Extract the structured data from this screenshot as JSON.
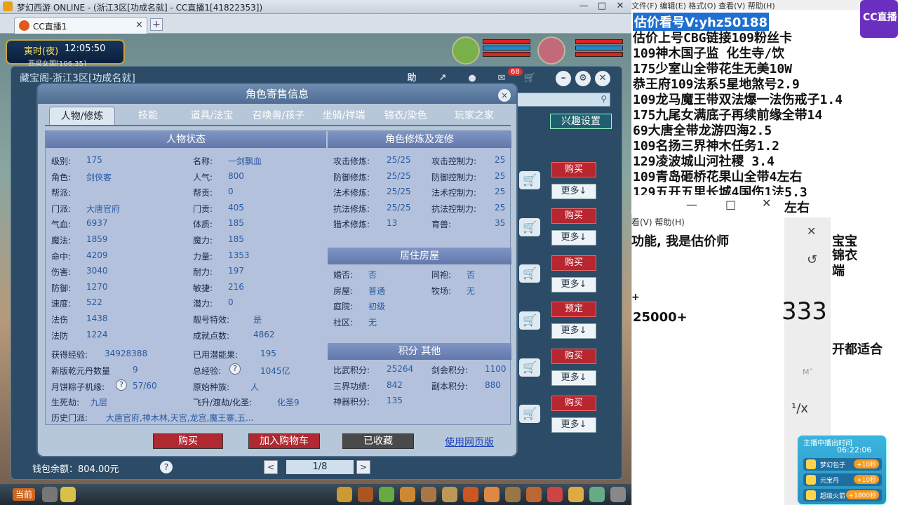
{
  "window": {
    "title": "梦幻西游 ONLINE - (浙江3区[功成名就] - CC直播1[41822353])"
  },
  "browser": {
    "tab_label": "CC直播1",
    "tab_close": "×",
    "new_tab": "+"
  },
  "clock": {
    "period": "寅时(夜)",
    "time": "12:05:50",
    "location": "西梁女国[106,35]"
  },
  "main": {
    "header": "藏宝阁-浙江3区[功成名就]",
    "help_icon": "助",
    "notify_count": "68",
    "hobby_button": "兴趣设置",
    "buttons": {
      "buy": "购买",
      "more": "更多↓",
      "reserve": "预定"
    },
    "wallet": "钱包余额：804.00元",
    "wallet_help": "?",
    "page": "1/8",
    "prev": "<",
    "next": ">"
  },
  "dialog": {
    "title": "角色寄售信息",
    "close": "×",
    "tabs": [
      "人物/修炼",
      "技能",
      "道具/法宝",
      "召唤兽/孩子",
      "坐骑/祥瑞",
      "锦衣/染色",
      "玩家之家"
    ],
    "status_title": "人物状态",
    "status_left": [
      [
        "级别:",
        "175"
      ],
      [
        "角色:",
        "剑侠客"
      ],
      [
        "帮派:",
        ""
      ],
      [
        "门派:",
        "大唐官府"
      ],
      [
        "气血:",
        "6937"
      ],
      [
        "魔法:",
        "1859"
      ],
      [
        "命中:",
        "4209"
      ],
      [
        "伤害:",
        "3040"
      ],
      [
        "防御:",
        "1270"
      ],
      [
        "速度:",
        "522"
      ],
      [
        "法伤",
        "1438"
      ],
      [
        "法防",
        "1224"
      ]
    ],
    "status_right": [
      [
        "名称:",
        "一剑飘血"
      ],
      [
        "人气:",
        "800"
      ],
      [
        "帮贡:",
        "0"
      ],
      [
        "门贡:",
        "405"
      ],
      [
        "体质:",
        "185"
      ],
      [
        "魔力:",
        "185"
      ],
      [
        "力量:",
        "1353"
      ],
      [
        "耐力:",
        "197"
      ],
      [
        "敏捷:",
        "216"
      ],
      [
        "潜力:",
        "0"
      ],
      [
        "靓号特效:",
        "是"
      ],
      [
        "成就点数:",
        "4862"
      ]
    ],
    "extra": {
      "exp_label": "获得经验:",
      "exp_val": "34928388",
      "potential_label": "已用潜能果:",
      "potential_val": "195",
      "qian_label": "新版乾元丹数量",
      "qian_val": "9",
      "total_exp_label": "总经验:",
      "total_exp_val": "1045亿",
      "mooncake_label": "月饼粽子机缘:",
      "mooncake_val": "57/60",
      "race_label": "原始种族:",
      "race_val": "人",
      "life_label": "生死劫:",
      "life_val": "九层",
      "fly_label": "飞升/渡劫/化圣:",
      "fly_val": "化圣9",
      "history_label": "历史门派:",
      "history_val": "大唐官府,神木林,天宫,龙宫,魔王寨,五...",
      "qmark": "?"
    },
    "cultivation_title": "角色修炼及宠修",
    "cultivation": [
      [
        "攻击修炼:",
        "25/25",
        "攻击控制力:",
        "25"
      ],
      [
        "防御修炼:",
        "25/25",
        "防御控制力:",
        "25"
      ],
      [
        "法术修炼:",
        "25/25",
        "法术控制力:",
        "25"
      ],
      [
        "抗法修炼:",
        "25/25",
        "抗法控制力:",
        "25"
      ],
      [
        "猎术修炼:",
        "13",
        "育兽:",
        "35"
      ]
    ],
    "house_title": "居住房屋",
    "house": [
      [
        "婚否:",
        "否",
        "同袍:",
        "否"
      ],
      [
        "房屋:",
        "普通",
        "牧场:",
        "无"
      ],
      [
        "庭院:",
        "初级",
        "",
        ""
      ],
      [
        "社区:",
        "无",
        "",
        ""
      ]
    ],
    "points_title": "积分 其他",
    "points": [
      [
        "比武积分:",
        "25264",
        "剑会积分:",
        "1100"
      ],
      [
        "三界功绩:",
        "842",
        "副本积分:",
        "880"
      ],
      [
        "神器积分:",
        "135",
        "",
        ""
      ]
    ],
    "actions": {
      "buy": "购买",
      "add_cart": "加入购物车",
      "favorited": "已收藏",
      "web": "使用网页版"
    }
  },
  "taskbar": {
    "current": "当前"
  },
  "right_panel": {
    "menu": "文件(F)    编辑(E)    格式(O)    查看(V)    帮助(H)",
    "highlight": "估价看号V:yhz50188",
    "lines": [
      "估价上号CBG链接109粉丝卡",
      "109神木国子监 化生寺/饮",
      "175少室山全带花生无美10W",
      "恭王府109法系5星地煞号2.9",
      "109龙马魔王带双法爆一法伤戒子1.4",
      "175九尾女满底子再续前缘全带14",
      "69大唐全带龙游四海2.5",
      "109名扬三界神木任务1.2",
      "129凌波城山河社稷  3.4",
      "109青岛砸桥花果山全带4左右",
      "129五开五里长城4国伤1法5.3",
      "左右"
    ],
    "cc_badge": "CC直播",
    "calc_help": "看(V)    帮助(H)",
    "notepad_line": "功能, 我是估价师",
    "plus": "+",
    "amount": "25000+",
    "big_num": "333",
    "m_label": "Mˆ",
    "recip": "¹/x",
    "side1": "宝宝",
    "side2": "锦衣",
    "side3": "端",
    "side4": "开都适合",
    "win_min": "—",
    "win_max": "□",
    "win_close": "✕"
  },
  "live": {
    "header": "主播中播出时间",
    "time": "06:22:06",
    "gifts": [
      [
        "梦幻包子",
        "+10秒"
      ],
      [
        "元宝丹",
        "+10秒"
      ],
      [
        "超级火箭",
        "+1800秒"
      ]
    ]
  },
  "colors": {
    "buy": "#b8262f",
    "dialog_header": "#4f6d92",
    "highlight": "#1e6fcf",
    "value": "#2a5aa0"
  }
}
